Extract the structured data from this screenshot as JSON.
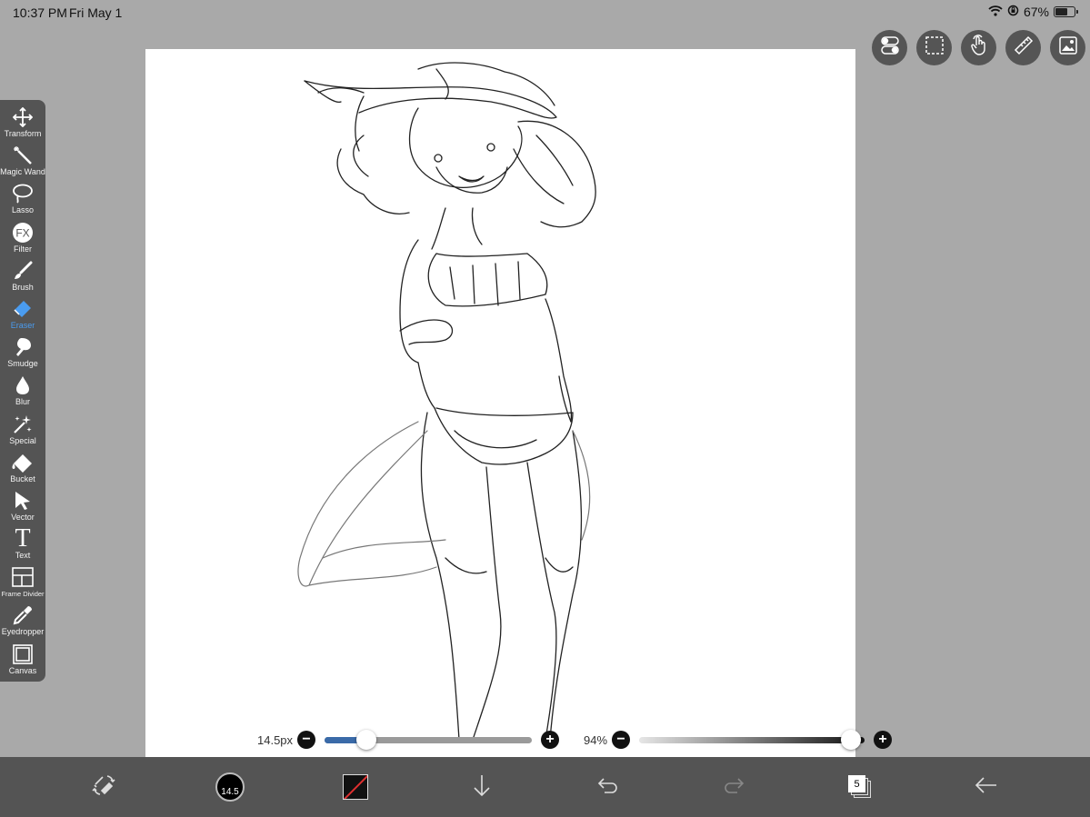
{
  "status_bar": {
    "time": "10:37 PM",
    "date": "Fri May 1",
    "battery_text": "67%",
    "battery_level": 0.67,
    "icons": [
      "wifi-icon",
      "orientation-lock-icon",
      "battery-icon"
    ]
  },
  "tools": [
    {
      "name": "transform",
      "label": "Transform",
      "icon": "move-arrows-icon"
    },
    {
      "name": "magic-wand",
      "label": "Magic Wand",
      "icon": "magic-wand-icon"
    },
    {
      "name": "lasso",
      "label": "Lasso",
      "icon": "lasso-icon"
    },
    {
      "name": "filter",
      "label": "Filter",
      "icon": "fx-icon",
      "glyph": "FX"
    },
    {
      "name": "brush",
      "label": "Brush",
      "icon": "brush-icon"
    },
    {
      "name": "eraser",
      "label": "Eraser",
      "icon": "eraser-icon",
      "active": true
    },
    {
      "name": "smudge",
      "label": "Smudge",
      "icon": "smudge-icon"
    },
    {
      "name": "blur",
      "label": "Blur",
      "icon": "drop-icon"
    },
    {
      "name": "special",
      "label": "Special",
      "icon": "sparkle-wand-icon"
    },
    {
      "name": "bucket",
      "label": "Bucket",
      "icon": "bucket-icon"
    },
    {
      "name": "vector",
      "label": "Vector",
      "icon": "pointer-arrow-icon"
    },
    {
      "name": "text",
      "label": "Text",
      "icon": "text-icon",
      "glyph": "T"
    },
    {
      "name": "frame-divider",
      "label": "Frame Divider",
      "icon": "frame-divider-icon"
    },
    {
      "name": "eyedropper",
      "label": "Eyedropper",
      "icon": "eyedropper-icon"
    },
    {
      "name": "canvas",
      "label": "Canvas",
      "icon": "canvas-icon"
    }
  ],
  "accent_color": "#4a9cf0",
  "top_tools": [
    "toggle-settings-icon",
    "selection-icon",
    "touch-gesture-icon",
    "ruler-icon",
    "material-image-icon"
  ],
  "brush_size": {
    "label": "14.5px",
    "minus": "−",
    "plus": "+",
    "value_fraction": 0.2
  },
  "opacity": {
    "label": "94%",
    "minus": "−",
    "plus": "+",
    "value_fraction": 0.94
  },
  "bottom_bar": {
    "brush_disc_text": "14.5",
    "layers_count": "5",
    "items": [
      "swap-brush-eraser-icon",
      "brush-size-disc",
      "color-swatch",
      "download-arrow-icon",
      "undo-icon",
      "redo-icon",
      "layers-icon",
      "back-arrow-icon"
    ]
  }
}
